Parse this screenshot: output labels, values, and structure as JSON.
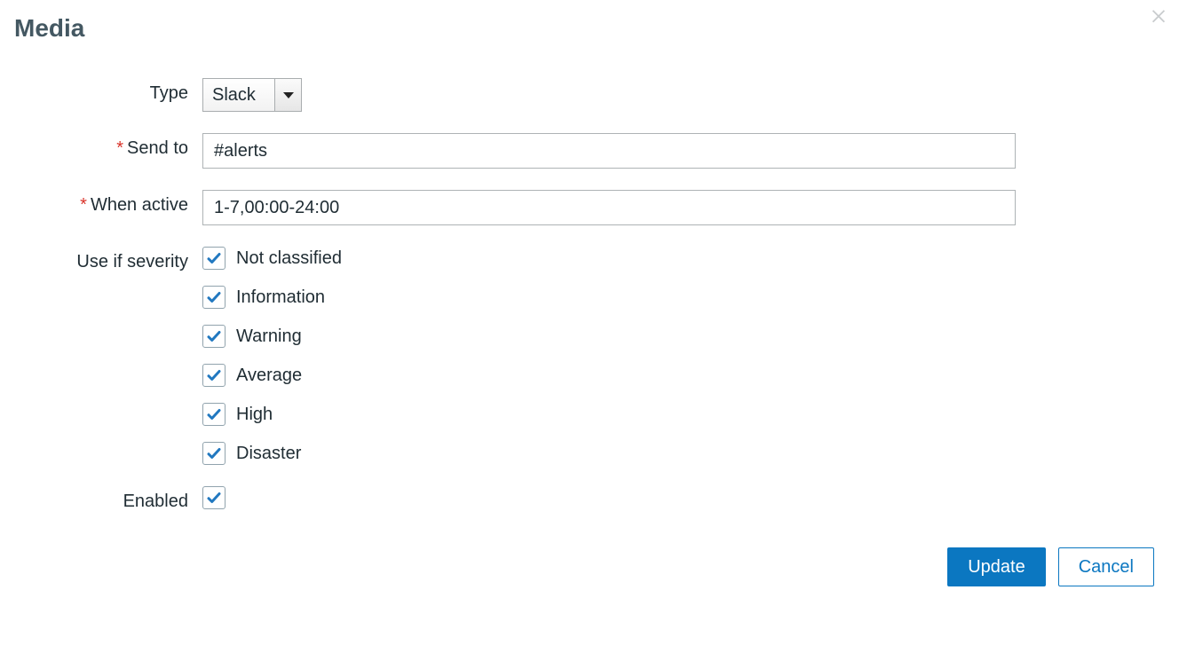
{
  "title": "Media",
  "form": {
    "type": {
      "label": "Type",
      "value": "Slack"
    },
    "send_to": {
      "label": "Send to",
      "value": "#alerts",
      "required": true
    },
    "when_active": {
      "label": "When active",
      "value": "1-7,00:00-24:00",
      "required": true
    },
    "use_if_severity": {
      "label": "Use if severity",
      "options": [
        {
          "label": "Not classified",
          "checked": true
        },
        {
          "label": "Information",
          "checked": true
        },
        {
          "label": "Warning",
          "checked": true
        },
        {
          "label": "Average",
          "checked": true
        },
        {
          "label": "High",
          "checked": true
        },
        {
          "label": "Disaster",
          "checked": true
        }
      ]
    },
    "enabled": {
      "label": "Enabled",
      "checked": true
    }
  },
  "buttons": {
    "update": "Update",
    "cancel": "Cancel"
  },
  "required_marker": "*",
  "colors": {
    "primary": "#0b77c1",
    "required": "#d9332a",
    "check": "#2178c0"
  }
}
